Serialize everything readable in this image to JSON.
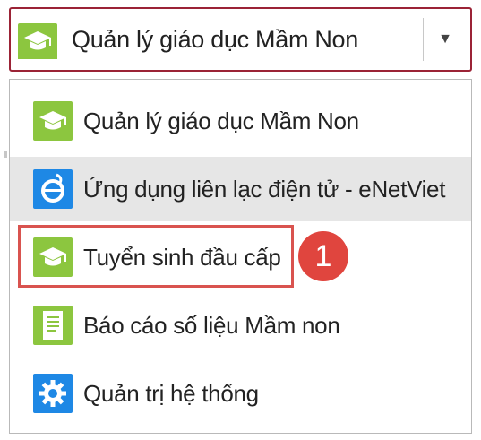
{
  "select": {
    "selected_label": "Quản lý giáo dục Mầm Non",
    "selected_icon": "graduation-cap-icon",
    "arrow": "▼"
  },
  "dropdown": {
    "items": [
      {
        "label": "Quản lý giáo dục Mầm Non",
        "icon": "graduation-cap-icon",
        "highlighted": false
      },
      {
        "label": "Ứng dụng liên lạc điện tử - eNetViet",
        "icon": "enetviet-logo-icon",
        "highlighted": true
      },
      {
        "label": "Tuyển sinh đầu cấp",
        "icon": "graduation-cap-icon",
        "highlighted": false
      },
      {
        "label": "Báo cáo số liệu Mầm non",
        "icon": "report-document-icon",
        "highlighted": false
      },
      {
        "label": "Quản trị hệ thống",
        "icon": "settings-gear-icon",
        "highlighted": false
      }
    ]
  },
  "annotation": {
    "step_number": "1"
  },
  "colors": {
    "accent_border": "#9b2336",
    "icon_green": "#8cc63f",
    "icon_blue": "#1e88e5",
    "callout_red": "#e0453e",
    "highlight_bg": "#e6e6e6"
  }
}
